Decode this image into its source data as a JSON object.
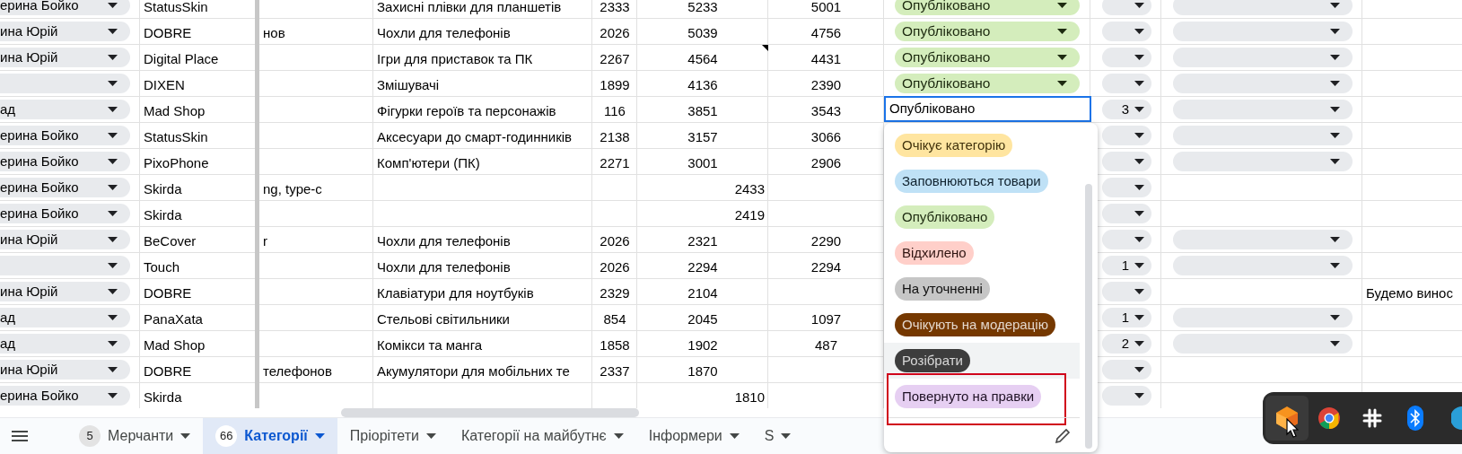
{
  "rows": [
    {
      "person": "ерина Бойко",
      "merchant": "StatusSkin",
      "category": "Захисні плівки для планшетів",
      "column_5": "2333",
      "column_6": "5233",
      "column_7": "5001",
      "status": {
        "text": "Опубліковано",
        "kind": "chip"
      },
      "column_10_dropdown": true
    },
    {
      "person": "ина Юрій",
      "merchant": "DOBRE",
      "column_3": "нов",
      "category": "Чохли для телефонів",
      "column_5": "2026",
      "column_6": "5039",
      "column_7": "4756",
      "status": {
        "text": "Опубліковано",
        "kind": "chip"
      },
      "column_10_dropdown": true
    },
    {
      "person": "ина Юрій",
      "merchant": "Digital Place",
      "category": "Ігри для приставок та ПК",
      "column_5": "2267",
      "column_6": "4564",
      "column_6_comment": true,
      "column_7": "4431",
      "status": {
        "text": "Опубліковано",
        "kind": "chip"
      },
      "column_10_dropdown": true
    },
    {
      "merchant": "DIXEN",
      "category": "Змішувачі",
      "column_5": "1899",
      "column_6": "4136",
      "column_7": "2390",
      "status": {
        "text": "Опубліковано",
        "kind": "chip"
      },
      "column_10_dropdown": true
    },
    {
      "person": "ад",
      "merchant": "Mad Shop",
      "category": "Фігурки героїв та персонажів",
      "column_5": "116",
      "column_6": "3851",
      "column_7": "3543",
      "status": {
        "text": "Опубліковано",
        "kind": "editing"
      },
      "column_9": "3",
      "column_10_dropdown": true
    },
    {
      "person": "ерина Бойко",
      "merchant": "StatusSkin",
      "category": "Аксесуари до смарт-годинників",
      "column_5": "2138",
      "column_6": "3157",
      "column_7": "3066",
      "column_10_dropdown": true
    },
    {
      "person": "ерина Бойко",
      "merchant": "PixoPhone",
      "category": "Комп'ютери (ПК)",
      "column_5": "2271",
      "column_6": "3001",
      "column_7": "2906",
      "column_10_dropdown": true
    },
    {
      "person": "ерина Бойко",
      "merchant": "Skirda",
      "column_3": "ng, type-c",
      "column_6": "2433",
      "column_6_right_aligned": true,
      "column_10_dropdown": false
    },
    {
      "person": "ерина Бойко",
      "merchant": "Skirda",
      "column_6": "2419",
      "column_6_right_aligned": true,
      "column_10_dropdown": false
    },
    {
      "person": "ина Юрій",
      "merchant": "BeCover",
      "column_3": "r",
      "category": "Чохли для телефонів",
      "column_5": "2026",
      "column_6": "2321",
      "column_7": "2290",
      "column_10_dropdown": true
    },
    {
      "merchant": "Touch",
      "category": "Чохли для телефонів",
      "column_5": "2026",
      "column_6": "2294",
      "column_7": "2294",
      "column_9": "1",
      "column_10_dropdown": true
    },
    {
      "person": "ина Юрій",
      "merchant": "DOBRE",
      "category": "Клавіатури для ноутбуків",
      "column_5": "2329",
      "column_6": "2104",
      "column_10_dropdown": false,
      "column_11": "Будемо винос"
    },
    {
      "person": "ад",
      "merchant": "PanaXata",
      "category": "Стельові світильники",
      "column_5": "854",
      "column_6": "2045",
      "column_7": "1097",
      "column_9": "1",
      "column_10_dropdown": true
    },
    {
      "person": "ад",
      "merchant": "Mad Shop",
      "category": "Комікси та манга",
      "column_5": "1858",
      "column_6": "1902",
      "column_7": "487",
      "column_9": "2",
      "column_10_dropdown": true
    },
    {
      "person": "ина Юрій",
      "merchant": "DOBRE",
      "column_3": "телефонов",
      "category": "Акумулятори для мобільних те",
      "column_5": "2337",
      "column_6": "1870",
      "column_10_dropdown": false
    },
    {
      "person": "ерина Бойко",
      "merchant": "Skirda",
      "column_6": "1810",
      "column_6_right_aligned": true,
      "column_10_dropdown": false
    }
  ],
  "status_menu": {
    "options": [
      {
        "label": "Очікує категорію",
        "color": "#ffe5a0",
        "hovered": false,
        "highlighted": false
      },
      {
        "label": "Заповнюються товари",
        "color": "#bfe1f6",
        "hovered": false,
        "highlighted": false
      },
      {
        "label": "Опубліковано",
        "color": "#d4edbc",
        "hovered": false,
        "highlighted": false
      },
      {
        "label": "Відхилено",
        "color": "#ffcfc9",
        "hovered": false,
        "highlighted": false
      },
      {
        "label": "На уточненні",
        "color": "#c6c6c6",
        "hovered": false,
        "highlighted": false
      },
      {
        "label": "Очікують на модерацію",
        "color": "#753800",
        "hovered": false,
        "highlighted": false
      },
      {
        "label": "Розібрати",
        "color": "#3d3d3d",
        "hovered": true,
        "highlighted": false
      },
      {
        "label": "Повернуто на правки",
        "color": "#e6cff2",
        "hovered": false,
        "highlighted": true
      }
    ]
  },
  "sheet_tabs": [
    {
      "count": "5",
      "label": "Мерчанти",
      "selected": false
    },
    {
      "count": "66",
      "label": "Категорії",
      "selected": true
    },
    {
      "label": "Пріорітети",
      "selected": false
    },
    {
      "label": "Категорії на майбутнє",
      "selected": false
    },
    {
      "label": "Інформери",
      "selected": false
    },
    {
      "label": "S",
      "selected": false
    }
  ]
}
